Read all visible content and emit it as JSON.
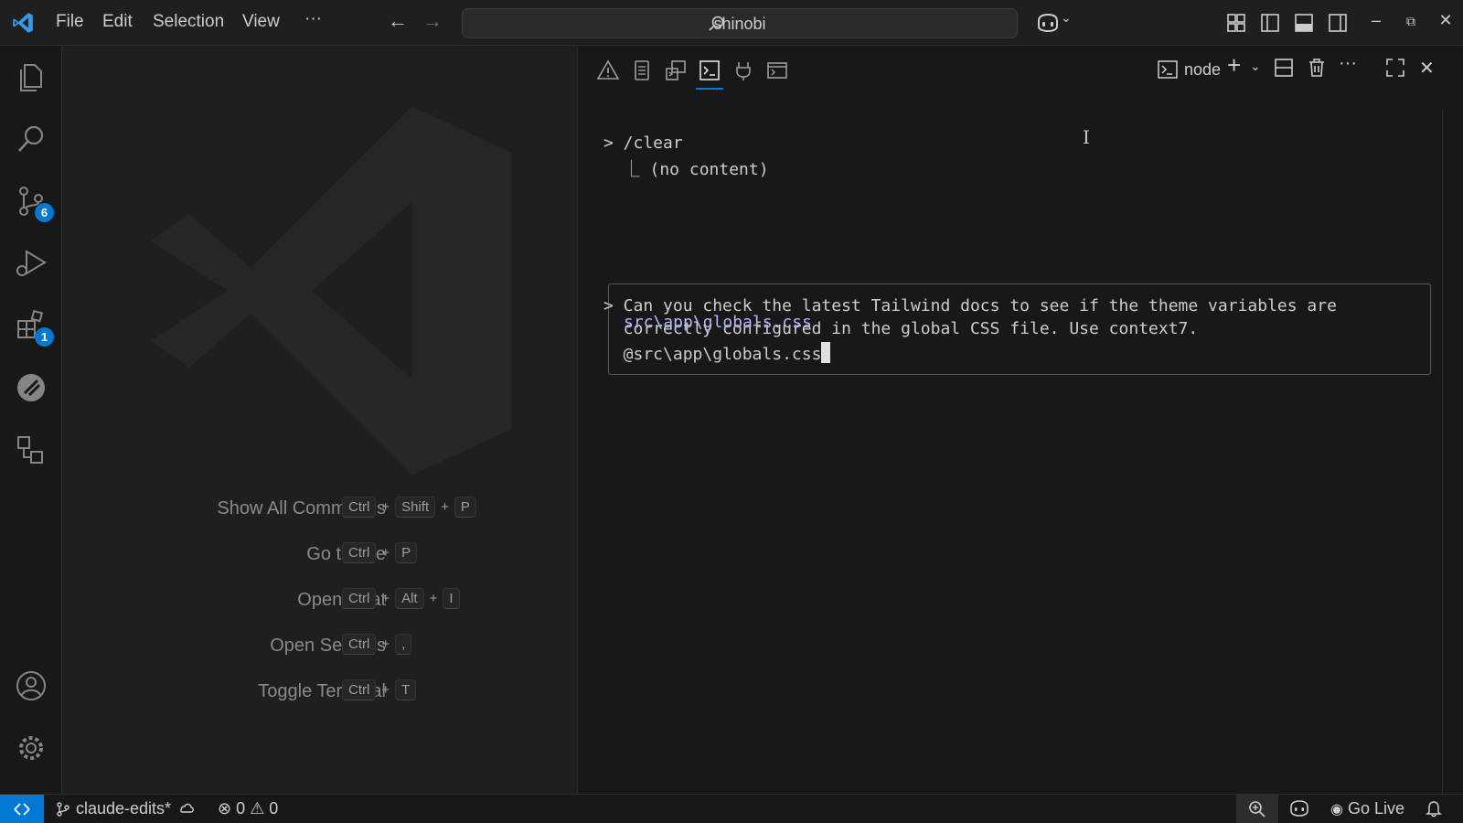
{
  "titlebar": {
    "menu": [
      "File",
      "Edit",
      "Selection",
      "View",
      "···"
    ],
    "search_text": "shinobi"
  },
  "activitybar": {
    "items": [
      {
        "name": "explorer"
      },
      {
        "name": "search"
      },
      {
        "name": "source-control",
        "badge": "6"
      },
      {
        "name": "run-debug"
      },
      {
        "name": "extensions",
        "badge": "1"
      },
      {
        "name": "remote-explorer"
      },
      {
        "name": "testing"
      }
    ]
  },
  "editor": {
    "shortcuts": [
      {
        "label": "Show All Commands",
        "keys": [
          "Ctrl",
          "Shift",
          "P"
        ]
      },
      {
        "label": "Go to File",
        "keys": [
          "Ctrl",
          "P"
        ]
      },
      {
        "label": "Open Chat",
        "keys": [
          "Ctrl",
          "Alt",
          "I"
        ]
      },
      {
        "label": "Open Settings",
        "keys": [
          "Ctrl",
          ","
        ]
      },
      {
        "label": "Toggle Terminal",
        "keys": [
          "Ctrl",
          "T"
        ]
      }
    ]
  },
  "panel": {
    "terminal_name": "node",
    "lines": {
      "clear_cmd": "> /clear",
      "clear_result": "  ⎿ (no content)",
      "prompt_line1": "> Can you check the latest Tailwind docs to see if the theme variables are",
      "prompt_line2": "  correctly configured in the global CSS file. Use context7.",
      "prompt_line3": "  @src\\app\\globals.css",
      "suggestion": "src\\app\\globals.css"
    }
  },
  "statusbar": {
    "branch": "claude-edits*",
    "errors": "0",
    "warnings": "0",
    "go_live": "Go Live"
  },
  "colors": {
    "accent": "#0078d4",
    "background": "#1f1f1f",
    "panel": "#181818",
    "suggestion": "#b4b7f5"
  }
}
